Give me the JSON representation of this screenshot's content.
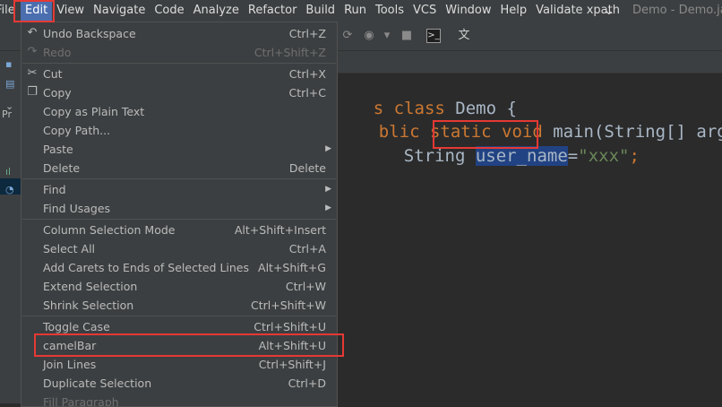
{
  "menubar": {
    "file": "File",
    "items": [
      "Edit",
      "View",
      "Navigate",
      "Code",
      "Analyze",
      "Refactor",
      "Build",
      "Run",
      "Tools",
      "VCS",
      "Window",
      "Help",
      "Validate xpath"
    ],
    "window_title": "Demo - Demo.java",
    "dropdown_glyph": "⌄"
  },
  "leftbar": {
    "project_label": "Pr"
  },
  "editor": {
    "line1": {
      "kw1": "s class ",
      "ident": "Demo {"
    },
    "line2": {
      "kw1": "blic static void ",
      "ident": "main(String[] args)"
    },
    "line3": {
      "type": "String ",
      "selected": "user_name",
      "eq": "=",
      "str": "\"xxx\"",
      "semi": ";"
    }
  },
  "edit_menu": {
    "undo": {
      "label": "Undo Backspace",
      "shortcut": "Ctrl+Z"
    },
    "redo": {
      "label": "Redo",
      "shortcut": "Ctrl+Shift+Z"
    },
    "cut": {
      "label": "Cut",
      "shortcut": "Ctrl+X"
    },
    "copy": {
      "label": "Copy",
      "shortcut": "Ctrl+C"
    },
    "copy_plain": {
      "label": "Copy as Plain Text"
    },
    "copy_path": {
      "label": "Copy Path..."
    },
    "paste": {
      "label": "Paste"
    },
    "delete": {
      "label": "Delete",
      "shortcut": "Delete"
    },
    "find": {
      "label": "Find"
    },
    "find_usages": {
      "label": "Find Usages"
    },
    "column_mode": {
      "label": "Column Selection Mode",
      "shortcut": "Alt+Shift+Insert"
    },
    "select_all": {
      "label": "Select All",
      "shortcut": "Ctrl+A"
    },
    "add_carets": {
      "label": "Add Carets to Ends of Selected Lines",
      "shortcut": "Alt+Shift+G"
    },
    "extend": {
      "label": "Extend Selection",
      "shortcut": "Ctrl+W"
    },
    "shrink": {
      "label": "Shrink Selection",
      "shortcut": "Ctrl+Shift+W"
    },
    "toggle_case": {
      "label": "Toggle Case",
      "shortcut": "Ctrl+Shift+U"
    },
    "camelbar": {
      "label": "camelBar",
      "shortcut": "Alt+Shift+U"
    },
    "join_lines": {
      "label": "Join Lines",
      "shortcut": "Ctrl+Shift+J"
    },
    "duplicate": {
      "label": "Duplicate Selection",
      "shortcut": "Ctrl+D"
    },
    "fill_paragraph": {
      "label": "Fill Paragraph"
    }
  },
  "icons": {
    "undo": "undo-icon",
    "redo": "redo-icon",
    "cut": "scissors-icon",
    "copy": "copy-icon",
    "terminal": "terminal-icon",
    "translate": "translate-icon"
  },
  "colors": {
    "accent": "#4b6eaf",
    "highlight": "#e53935",
    "selection": "#214283"
  }
}
